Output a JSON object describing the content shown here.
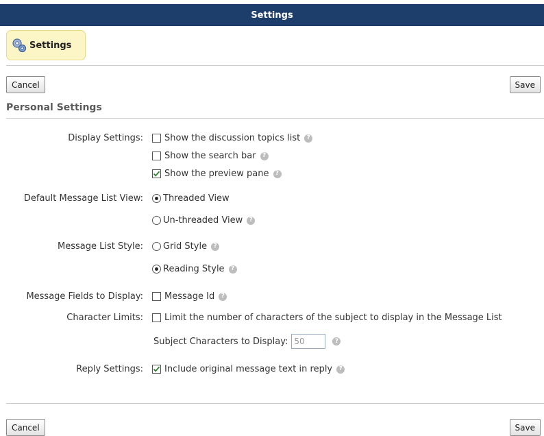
{
  "window": {
    "title": "Settings"
  },
  "tab": {
    "label": "Settings"
  },
  "buttons": {
    "cancel": "Cancel",
    "save": "Save"
  },
  "section": {
    "title": "Personal Settings"
  },
  "display_settings": {
    "label": "Display Settings:",
    "options": [
      {
        "text": "Show the discussion topics list",
        "checked": false
      },
      {
        "text": "Show the search bar",
        "checked": false
      },
      {
        "text": "Show the preview pane",
        "checked": true
      }
    ]
  },
  "message_list_view": {
    "label": "Default Message List View:",
    "options": [
      {
        "text": "Threaded View",
        "selected": true
      },
      {
        "text": "Un-threaded View",
        "selected": false
      }
    ]
  },
  "message_list_style": {
    "label": "Message List Style:",
    "options": [
      {
        "text": "Grid Style",
        "selected": false
      },
      {
        "text": "Reading Style",
        "selected": true
      }
    ]
  },
  "message_fields": {
    "label": "Message Fields to Display:",
    "option": {
      "text": "Message Id",
      "checked": false
    }
  },
  "character_limits": {
    "label": "Character Limits:",
    "option": {
      "text": "Limit the number of characters of the subject to display in the Message List",
      "checked": false
    },
    "subject_label": "Subject Characters to Display:",
    "subject_value": "50"
  },
  "reply_settings": {
    "label": "Reply Settings:",
    "option": {
      "text": "Include original message text in reply",
      "checked": true
    }
  },
  "help_icon": "?",
  "colors": {
    "titlebar": "#1d3e6b",
    "tab_bg": "#fcf6c6"
  }
}
